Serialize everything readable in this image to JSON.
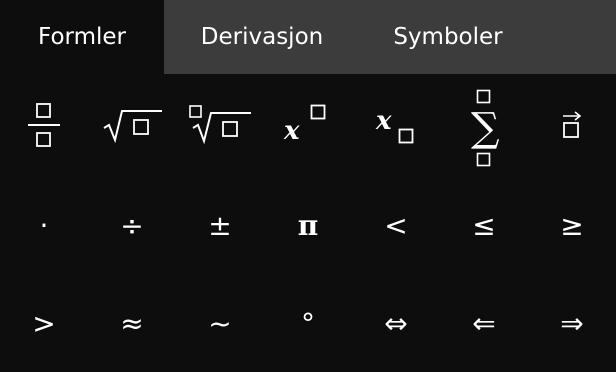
{
  "tabs": [
    {
      "label": "Formler",
      "active": true
    },
    {
      "label": "Derivasjon",
      "active": false
    },
    {
      "label": "Symboler",
      "active": false
    }
  ],
  "formula_row": [
    {
      "name": "fraction-button"
    },
    {
      "name": "sqrt-button"
    },
    {
      "name": "nth-root-button"
    },
    {
      "name": "superscript-button",
      "glyph": "x"
    },
    {
      "name": "subscript-button",
      "glyph": "x"
    },
    {
      "name": "sum-button",
      "glyph": "∑"
    },
    {
      "name": "vector-button"
    }
  ],
  "symbol_rows": [
    [
      {
        "name": "dot-operator-button",
        "glyph": "·"
      },
      {
        "name": "division-button",
        "glyph": "÷"
      },
      {
        "name": "plus-minus-button",
        "glyph": "±"
      },
      {
        "name": "pi-button",
        "glyph": "π"
      },
      {
        "name": "less-than-button",
        "glyph": "<"
      },
      {
        "name": "less-equal-button",
        "glyph": "≤"
      },
      {
        "name": "greater-equal-button",
        "glyph": "≥"
      }
    ],
    [
      {
        "name": "greater-than-button",
        "glyph": ">"
      },
      {
        "name": "approx-button",
        "glyph": "≈"
      },
      {
        "name": "tilde-button",
        "glyph": "~"
      },
      {
        "name": "degree-button",
        "glyph": "°"
      },
      {
        "name": "iff-arrow-button",
        "glyph": "⇔"
      },
      {
        "name": "implied-by-arrow-button",
        "glyph": "⇐"
      },
      {
        "name": "implies-arrow-button",
        "glyph": "⇒"
      }
    ]
  ]
}
